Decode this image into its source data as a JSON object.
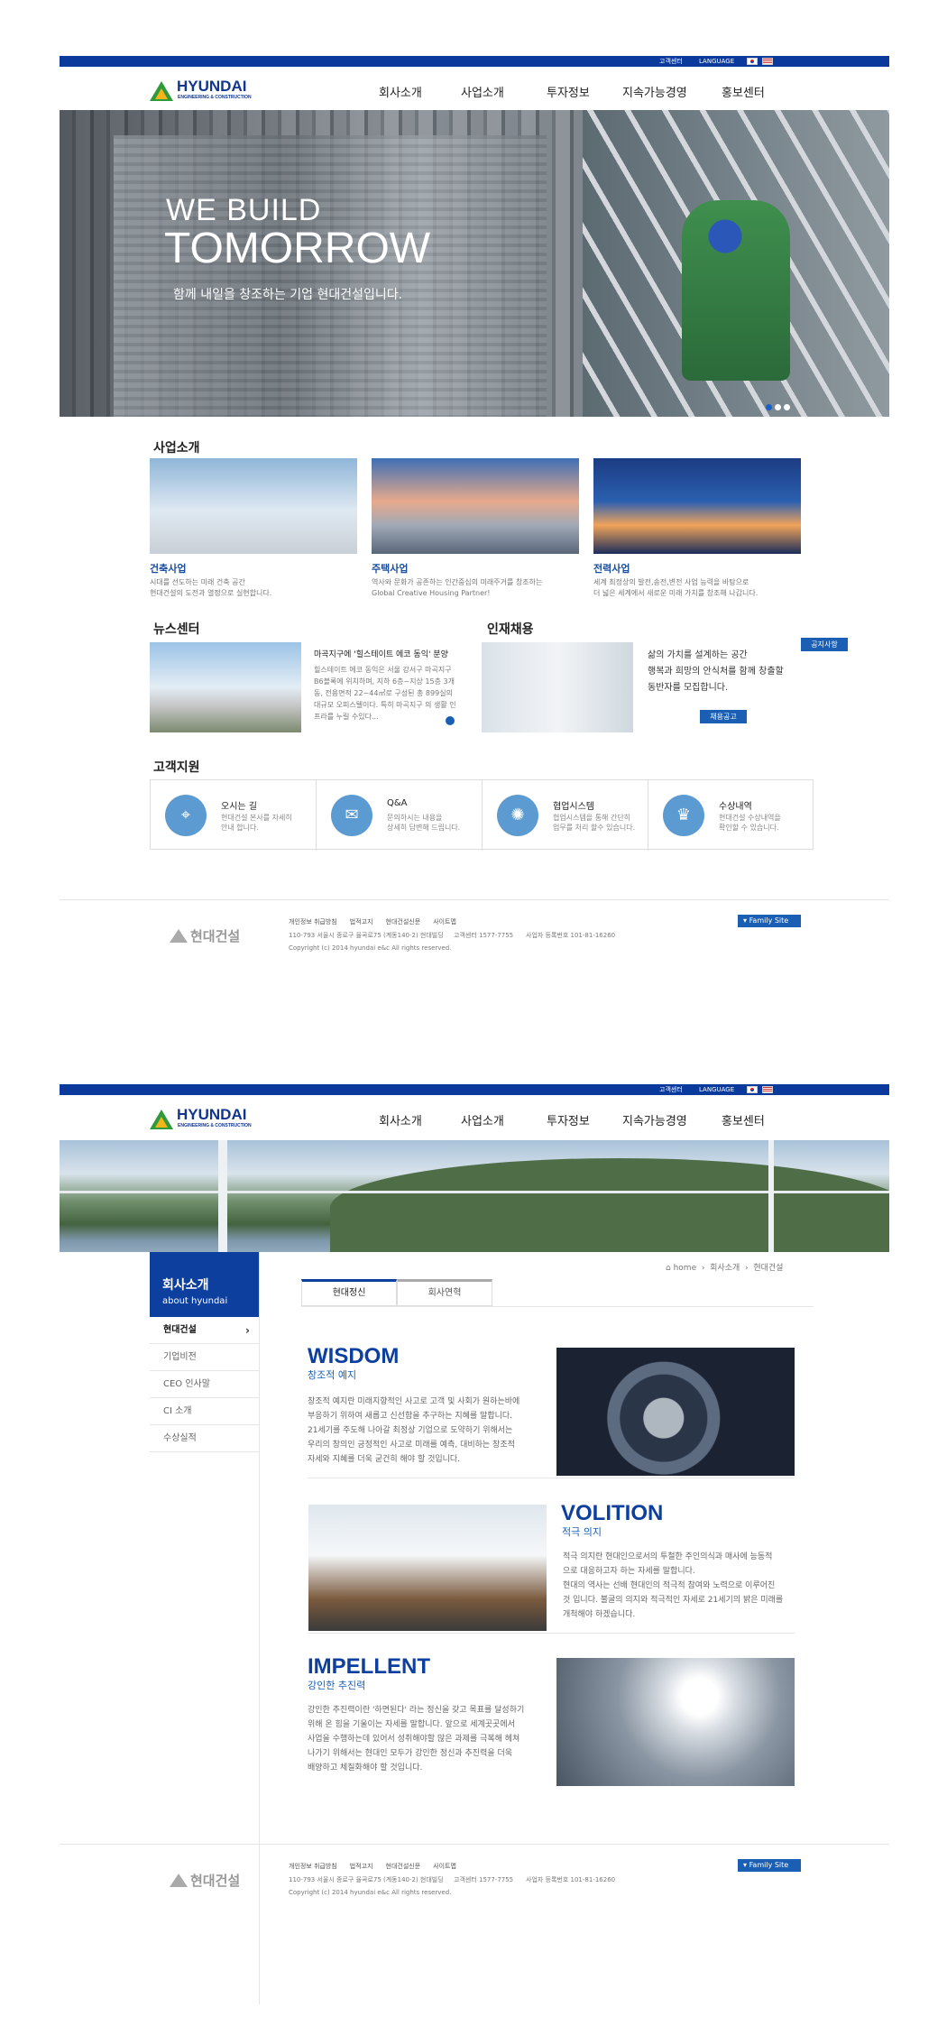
{
  "topbar": {
    "global": "고객센터",
    "language": "LANGUAGE"
  },
  "logo": {
    "name": "HYUNDAI",
    "sub": "ENGINEERING & CONSTRUCTION"
  },
  "nav": [
    "회사소개",
    "사업소개",
    "투자정보",
    "지속가능경영",
    "홍보센터"
  ],
  "hero": {
    "line1": "WE BUILD",
    "line2": "TOMORROW",
    "line3": "함께 내일을 창조하는 기업 현대건설입니다."
  },
  "business": {
    "title": "사업소개",
    "cards": [
      {
        "title": "건축사업",
        "desc1": "시대를 선도하는 미래 건축 공간",
        "desc2": "현대건설의 도전과 열정으로 실현합니다."
      },
      {
        "title": "주택사업",
        "desc1": "역사와 문화가 공존하는 인간중심의 미래주거를 창조하는",
        "desc2": "Global Creative Housing Partner!"
      },
      {
        "title": "전력사업",
        "desc1": "세계 최정상의 발전,송전,변전 사업 능력을 바탕으로",
        "desc2": "더 넓은 세계에서 새로운 미래 가치를 창조해 나갑니다."
      }
    ]
  },
  "news": {
    "title": "뉴스센터",
    "headline": "마곡지구에 '힐스테이트 에코 동익' 분양",
    "body": "힐스테이트 에코 동익은 서울 강서구 마곡지구 B6블록에 위치하며, 지하 6층~지상 15층 3개동, 전용면적 22~44㎡로 구성된 총 899실의 대규모 오피스텔이다. 특히 마곡지구 의 생활 인프라를 누릴 수있다..."
  },
  "recruit": {
    "title": "인재채용",
    "badge": "공지사항",
    "line1": "삶의 가치를 설계하는 공간",
    "line2": "행복과 희망의 안식처를 함께 창출할",
    "line3": "동반자를 모집합니다.",
    "button": "채용공고"
  },
  "support": {
    "title": "고객지원",
    "items": [
      {
        "title": "오시는 길",
        "d1": "현대건설 본사를 자세히",
        "d2": "안내 합니다."
      },
      {
        "title": "Q&A",
        "d1": "문의하시는 내용을",
        "d2": "상세히 답변해 드립니다."
      },
      {
        "title": "협업시스템",
        "d1": "협업시스템을 통해 간단히",
        "d2": "업무를 처리 할수 있습니다."
      },
      {
        "title": "수상내역",
        "d1": "현대건설 수상내역을",
        "d2": "확인할 수 있습니다."
      }
    ]
  },
  "footer": {
    "logo": "현대건설",
    "links": [
      "개인정보 취급방침",
      "법적고지",
      "현대건설신문",
      "사이트맵"
    ],
    "address": "110-793 서울시 종로구 율곡로75 (계동140-2) 현대빌딩",
    "center": "고객센터 1577-7755",
    "biz": "사업자 등록번호 101-81-16260",
    "copy": "Copyright (c) 2014 hyundai e&c All rights reserved.",
    "family": "Family Site"
  },
  "sub": {
    "side_title": "회사소개",
    "side_sub": "about hyundai",
    "side_items": [
      "현대건설",
      "기업비전",
      "CEO 인사말",
      "CI 소개",
      "수상실적"
    ],
    "crumb": [
      "home",
      "회사소개",
      "현대건설"
    ],
    "tabs": [
      "현대정신",
      "회사연혁"
    ],
    "values": [
      {
        "title": "WISDOM",
        "sub": "창조적 예지",
        "lines": [
          "창조적 예지란 미래지향적인 사고로 고객 및 사회가 원하는바에",
          "부응하기 위하여 새롭고 신선함을 추구하는 지혜를 말합니다.",
          "21세기를 주도해 나아갈 최정상 기업으로 도약하기 위해서는",
          "우리의 창의인 긍정적인 사고로 미래를 예측, 대비하는 창조적",
          "자세와 지혜를 더욱 굳건히 해야 할 것입니다."
        ]
      },
      {
        "title": "VOLITION",
        "sub": "적극 의지",
        "lines": [
          "적극 의지란 현대인으로서의 투철한 주인의식과 매사에 능동적",
          "으로 대응하고자 하는 자세를 말합니다.",
          "현대의 역사는 선배 현대인의 적극적 참여와 노력으로 이루어진",
          "것 입니다. 불굴의 의지와 적극적인 자세로 21세기의 밝은 미래를",
          "개척해야 하겠습니다."
        ]
      },
      {
        "title": "IMPELLENT",
        "sub": "강인한 추진력",
        "lines": [
          "강인한 추진력이란 '하면된다' 라는 정신을 갖고 목표를 달성하기",
          "위해 온 힘을 기울이는 자세를 말합니다. 앞으로 세계곳곳에서",
          "사업을 수행하는데 있어서 성취해야할 많은 과제를 극복해 헤쳐",
          "나가기 위해서는 현대인 모두가 강인한 정신과 추진력을 더욱",
          "배양하고 체질화해야 할 것입니다."
        ]
      }
    ]
  },
  "colors": {
    "primary": "#0c3f9e",
    "accent": "#1a5fb4"
  }
}
